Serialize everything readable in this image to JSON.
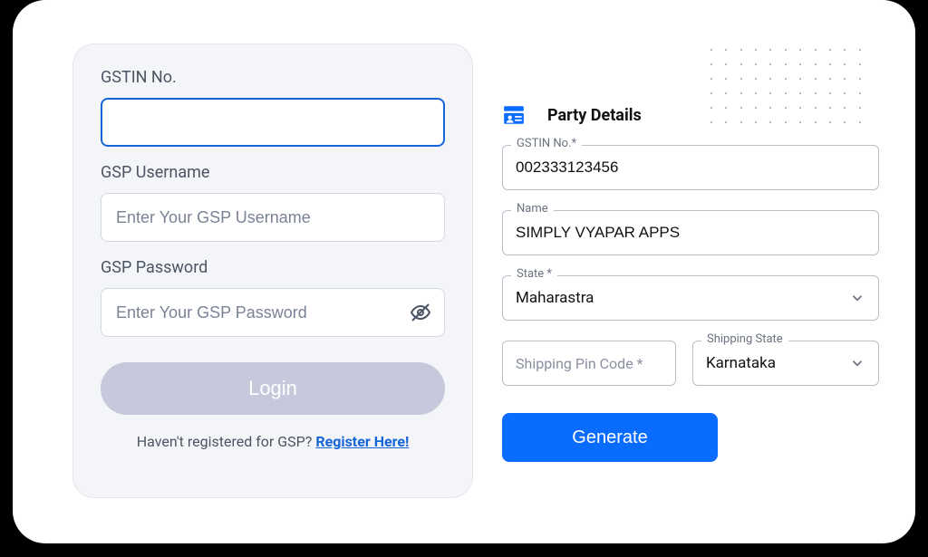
{
  "login": {
    "gstin_label": "GSTIN No.",
    "gstin_value": "",
    "gsp_username_label": "GSP Username",
    "gsp_username_placeholder": "Enter Your GSP Username",
    "gsp_password_label": "GSP Password",
    "gsp_password_placeholder": "Enter Your GSP Password",
    "login_button": "Login",
    "register_prompt": "Haven't registered for GSP? ",
    "register_link": "Register Here!"
  },
  "party": {
    "title": "Party Details",
    "gstin_label": "GSTIN No.*",
    "gstin_value": "002333123456",
    "name_label": "Name",
    "name_value": "SIMPLY VYAPAR APPS",
    "state_label": "State *",
    "state_value": "Maharastra",
    "shipping_pin_label": "Shipping Pin Code *",
    "shipping_state_label": "Shipping State",
    "shipping_state_value": "Karnataka",
    "generate_button": "Generate"
  }
}
